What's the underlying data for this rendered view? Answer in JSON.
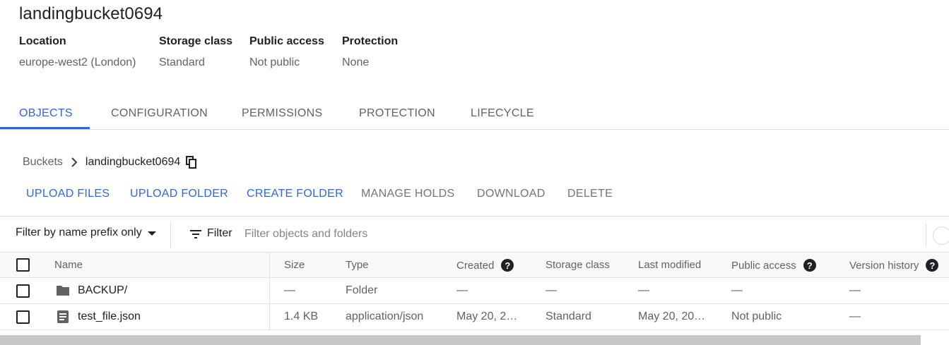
{
  "bucket": {
    "title": "landingbucket0694",
    "meta": [
      {
        "label": "Location",
        "value": "europe-west2 (London)"
      },
      {
        "label": "Storage class",
        "value": "Standard"
      },
      {
        "label": "Public access",
        "value": "Not public"
      },
      {
        "label": "Protection",
        "value": "None"
      }
    ]
  },
  "tabs": [
    {
      "label": "OBJECTS",
      "active": true
    },
    {
      "label": "CONFIGURATION"
    },
    {
      "label": "PERMISSIONS"
    },
    {
      "label": "PROTECTION"
    },
    {
      "label": "LIFECYCLE"
    }
  ],
  "breadcrumb": {
    "root": "Buckets",
    "current": "landingbucket0694",
    "separator_icon": "chevron-right-icon",
    "copy_icon": "copy-icon"
  },
  "actions": [
    {
      "label": "UPLOAD FILES",
      "enabled": true
    },
    {
      "label": "UPLOAD FOLDER",
      "enabled": true
    },
    {
      "label": "CREATE FOLDER",
      "enabled": true
    },
    {
      "label": "MANAGE HOLDS",
      "enabled": false
    },
    {
      "label": "DOWNLOAD",
      "enabled": false
    },
    {
      "label": "DELETE",
      "enabled": false
    }
  ],
  "filter": {
    "mode": "Filter by name prefix only",
    "label": "Filter",
    "placeholder": "Filter objects and folders",
    "icon": "filter-list-icon"
  },
  "table": {
    "columns": [
      {
        "label": "Name"
      },
      {
        "label": "Size"
      },
      {
        "label": "Type"
      },
      {
        "label": "Created",
        "help": "?"
      },
      {
        "label": "Storage class"
      },
      {
        "label": "Last modified"
      },
      {
        "label": "Public access",
        "help": "?"
      },
      {
        "label": "Version history",
        "help": "?"
      }
    ],
    "rows": [
      {
        "icon": "folder-icon",
        "name": "BACKUP/",
        "size": "—",
        "type": "Folder",
        "created": "—",
        "storage_class": "—",
        "last_modified": "—",
        "public_access": "—",
        "version_history": "—"
      },
      {
        "icon": "document-icon",
        "name": "test_file.json",
        "size": "1.4 KB",
        "type": "application/json",
        "created": "May 20, 2…",
        "storage_class": "Standard",
        "last_modified": "May 20, 20…",
        "public_access": "Not public",
        "version_history": "—"
      }
    ]
  },
  "colors": {
    "accent": "#3367d6",
    "text_primary": "#202124",
    "text_secondary": "#5f6368",
    "disabled": "#757575",
    "divider": "#e0e0e0",
    "header_bg": "#f8f9fa"
  }
}
